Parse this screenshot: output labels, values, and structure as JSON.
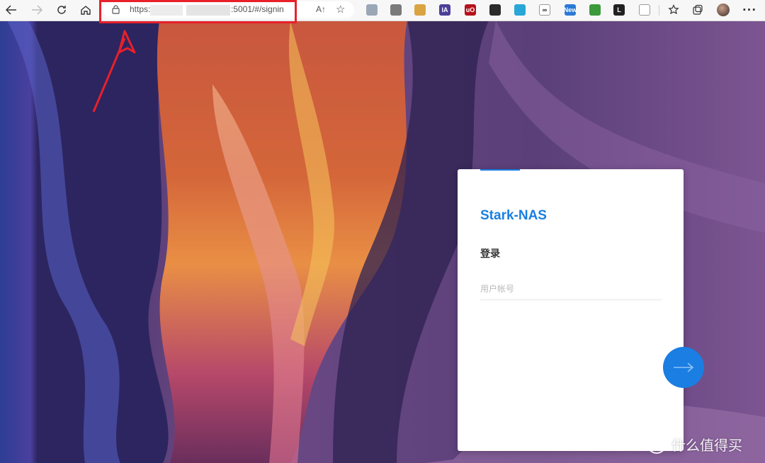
{
  "browser": {
    "url_prefix": "https:/",
    "url_suffix": ":5001/#/signin",
    "read_aloud_label": "A↑",
    "icons": [
      "back-icon",
      "forward-icon",
      "refresh-icon",
      "home-icon",
      "lock-icon",
      "read-aloud-icon",
      "add-favorite-icon",
      "favorites-icon",
      "collections-icon",
      "profile-avatar",
      "more-icon"
    ],
    "extensions": [
      {
        "name": "extension-shield",
        "label": "",
        "color": "#9aa7b6"
      },
      {
        "name": "extension-book",
        "label": "",
        "color": "#7a7a7a"
      },
      {
        "name": "extension-face",
        "label": "",
        "color": "#d9a441"
      },
      {
        "name": "extension-ia",
        "label": "IA",
        "color": "#4b3f9a"
      },
      {
        "name": "extension-ublock",
        "label": "uO",
        "color": "#b5121b"
      },
      {
        "name": "extension-dark",
        "label": "",
        "color": "#2b2b2b"
      },
      {
        "name": "extension-shield-color",
        "label": "",
        "color": "#28a6d8"
      },
      {
        "name": "extension-infinity",
        "label": "∞",
        "color": "#ffffff"
      },
      {
        "name": "extension-new",
        "label": "New",
        "color": "#2b79d6"
      },
      {
        "name": "extension-globe",
        "label": "",
        "color": "#3c9a3c"
      },
      {
        "name": "extension-l",
        "label": "L",
        "color": "#222222"
      },
      {
        "name": "extension-puzzle",
        "label": "",
        "color": "#ffffff"
      }
    ]
  },
  "login": {
    "brand": "Stark-NAS",
    "title": "登录",
    "username_placeholder": "用户帐号",
    "username_value": ""
  },
  "colors": {
    "accent": "#1a7ee2",
    "annotation": "#e8202a"
  },
  "watermark": {
    "text": "什么值得买"
  }
}
